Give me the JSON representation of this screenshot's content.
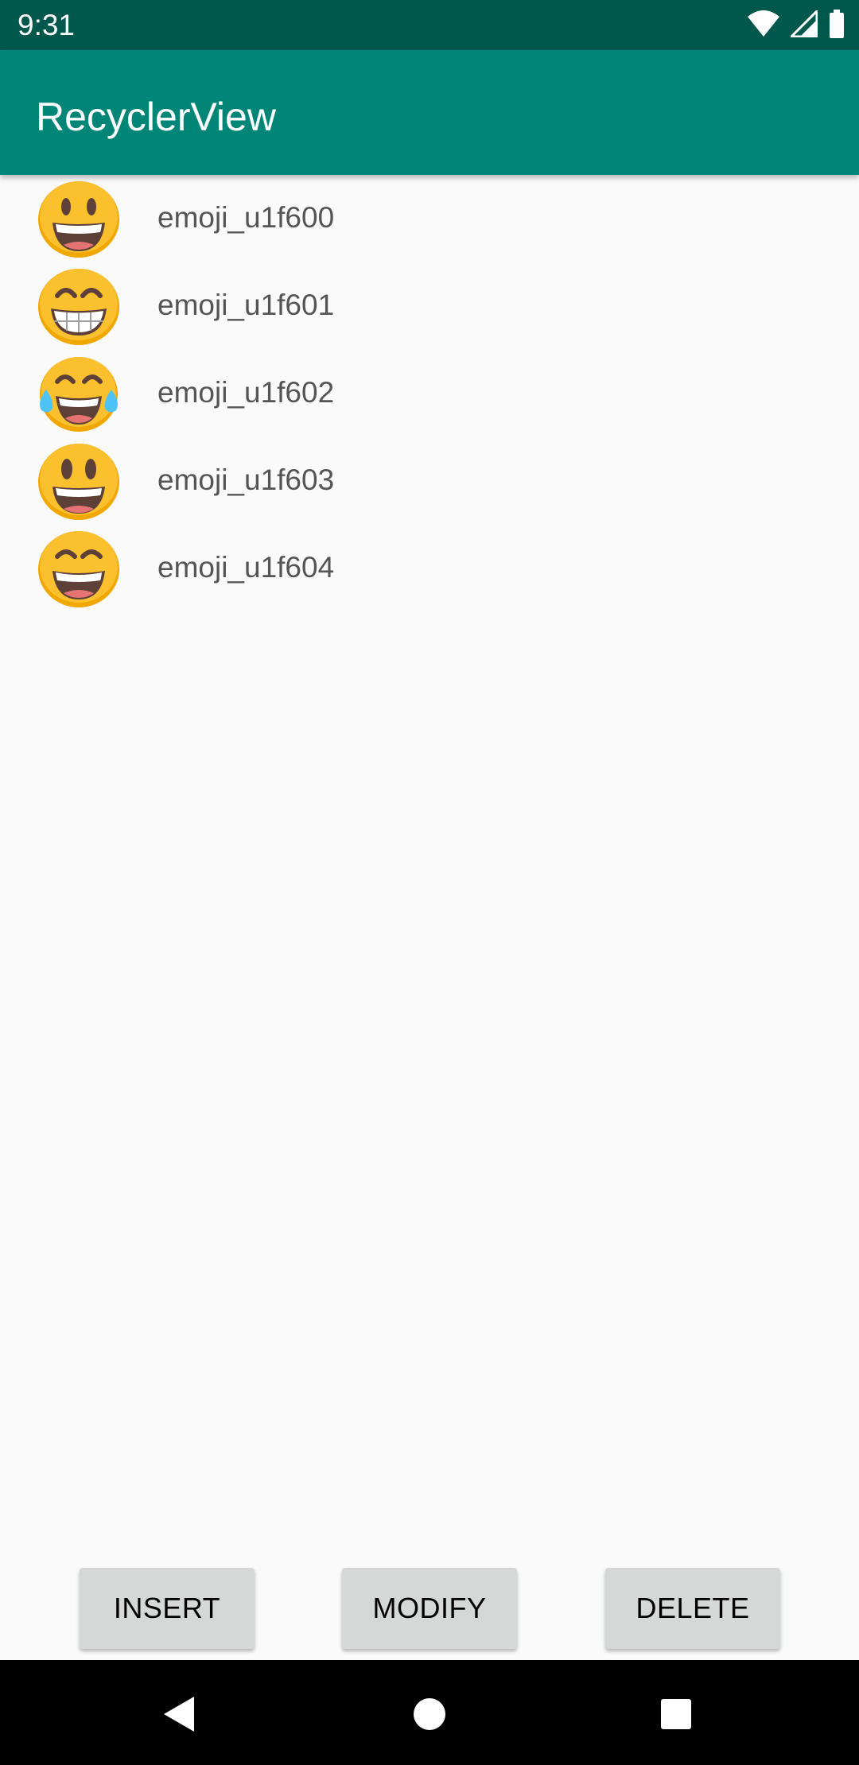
{
  "status_bar": {
    "time": "9:31",
    "icons": [
      "wifi-icon",
      "cell-signal-icon",
      "battery-icon"
    ],
    "background": "#00574b"
  },
  "app_bar": {
    "title": "RecyclerView",
    "background": "#008577"
  },
  "list": {
    "items": [
      {
        "label": "emoji_u1f600",
        "icon": "grinning-face-emoji-icon"
      },
      {
        "label": "emoji_u1f601",
        "icon": "beaming-face-emoji-icon"
      },
      {
        "label": "emoji_u1f602",
        "icon": "tears-of-joy-emoji-icon"
      },
      {
        "label": "emoji_u1f603",
        "icon": "smiley-big-eyes-emoji-icon"
      },
      {
        "label": "emoji_u1f604",
        "icon": "smiling-eyes-emoji-icon"
      }
    ]
  },
  "actions": {
    "insert_label": "INSERT",
    "modify_label": "MODIFY",
    "delete_label": "DELETE"
  },
  "nav_bar": {
    "icons": [
      "back-icon",
      "home-icon",
      "recents-icon"
    ]
  },
  "colors": {
    "emoji_face": "#fbc02d",
    "emoji_shade": "#f0a800",
    "tear": "#4fc3f7",
    "mouth": "#5d4037"
  }
}
